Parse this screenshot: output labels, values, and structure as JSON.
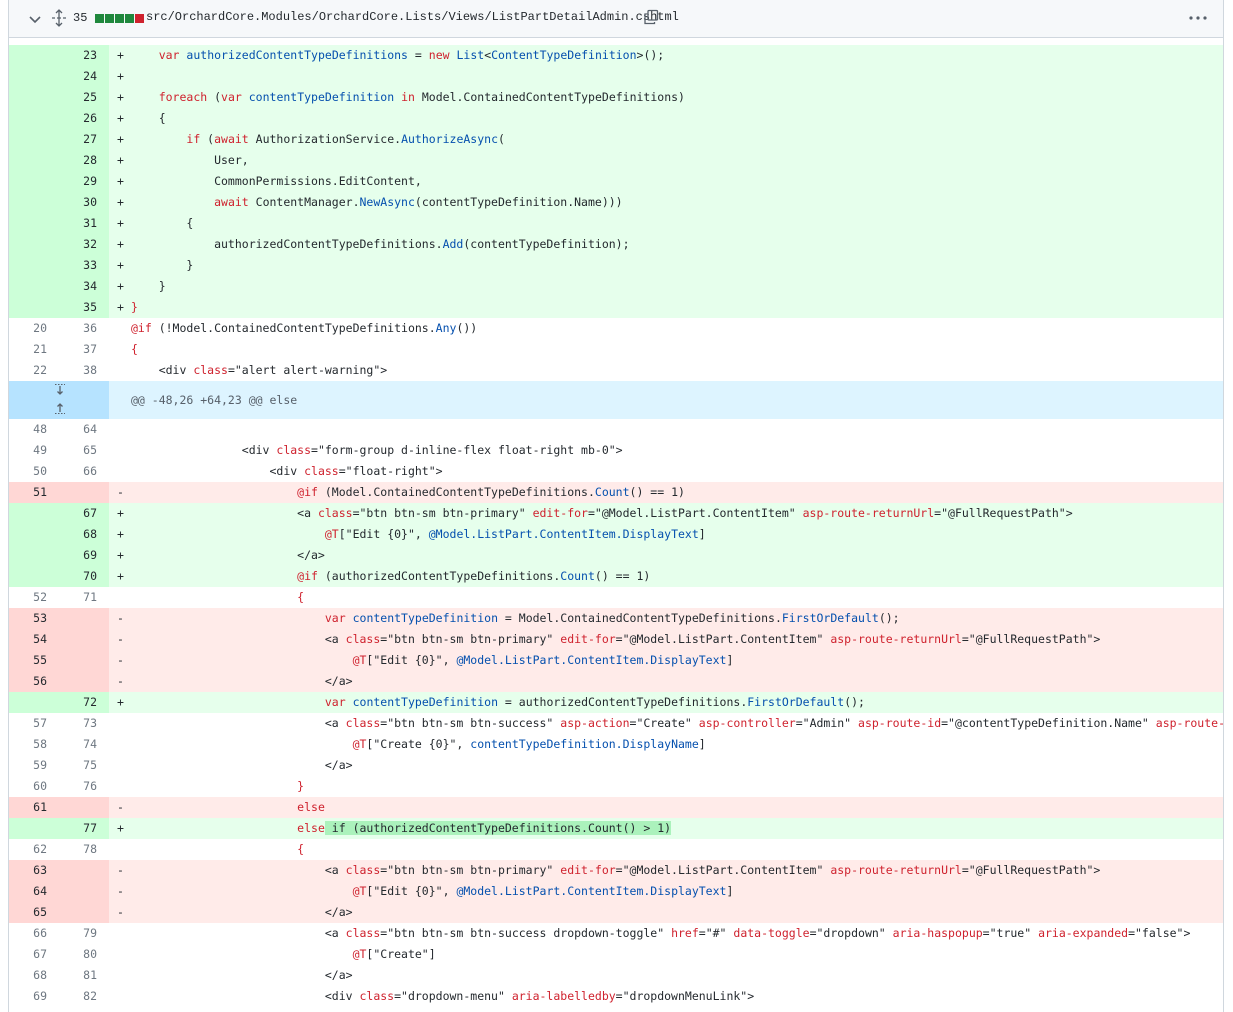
{
  "file": {
    "lines_changed": "35",
    "diff_bars": [
      "#1f883d",
      "#1f883d",
      "#1f883d",
      "#1f883d",
      "#cf222e"
    ],
    "path": "src/OrchardCore.Modules/OrchardCore.Lists/Views/ListPartDetailAdmin.cshtml",
    "icons": {
      "collapse": "chevron-down-icon",
      "expand": "unfold-icon",
      "copy": "copy-icon",
      "menu": "kebab-horizontal-icon"
    }
  },
  "hunk": {
    "header": "@@ -48,26 +64,23 @@ else"
  },
  "colors": {
    "add_bg": "#e6ffec",
    "add_gutter": "#ccffd8",
    "del_bg": "#ffebe9",
    "del_gutter": "#ffd7d5",
    "hunk_bg": "#ddf4ff",
    "hunk_gutter": "#b6e3ff"
  },
  "lines": [
    {
      "t": "add",
      "o": "",
      "n": "23",
      "m": "+",
      "s": [
        [
          "    ",
          ""
        ],
        [
          "var",
          "kw"
        ],
        [
          " ",
          ""
        ],
        [
          "authorizedContentTypeDefinitions",
          "at"
        ],
        [
          " = ",
          ""
        ],
        [
          "new",
          "kw"
        ],
        [
          " ",
          ""
        ],
        [
          "List",
          "at"
        ],
        [
          "<",
          ""
        ],
        [
          "ContentTypeDefinition",
          "at"
        ],
        [
          ">();",
          ""
        ]
      ]
    },
    {
      "t": "add",
      "o": "",
      "n": "24",
      "m": "+",
      "s": []
    },
    {
      "t": "add",
      "o": "",
      "n": "25",
      "m": "+",
      "s": [
        [
          "    ",
          ""
        ],
        [
          "foreach",
          "kw"
        ],
        [
          " (",
          ""
        ],
        [
          "var",
          "kw"
        ],
        [
          " ",
          ""
        ],
        [
          "contentTypeDefinition",
          "at"
        ],
        [
          " ",
          ""
        ],
        [
          "in",
          "kw"
        ],
        [
          " Model.ContainedContentTypeDefinitions)",
          ""
        ]
      ]
    },
    {
      "t": "add",
      "o": "",
      "n": "26",
      "m": "+",
      "s": [
        [
          "    {",
          ""
        ]
      ]
    },
    {
      "t": "add",
      "o": "",
      "n": "27",
      "m": "+",
      "s": [
        [
          "        ",
          ""
        ],
        [
          "if",
          "kw"
        ],
        [
          " (",
          ""
        ],
        [
          "await",
          "kw"
        ],
        [
          " AuthorizationService.",
          ""
        ],
        [
          "AuthorizeAsync",
          "at"
        ],
        [
          "(",
          ""
        ]
      ]
    },
    {
      "t": "add",
      "o": "",
      "n": "28",
      "m": "+",
      "s": [
        [
          "            User,",
          ""
        ]
      ]
    },
    {
      "t": "add",
      "o": "",
      "n": "29",
      "m": "+",
      "s": [
        [
          "            CommonPermissions.EditContent,",
          ""
        ]
      ]
    },
    {
      "t": "add",
      "o": "",
      "n": "30",
      "m": "+",
      "s": [
        [
          "            ",
          ""
        ],
        [
          "await",
          "kw"
        ],
        [
          " ContentManager.",
          ""
        ],
        [
          "NewAsync",
          "at"
        ],
        [
          "(contentTypeDefinition.Name)))",
          ""
        ]
      ]
    },
    {
      "t": "add",
      "o": "",
      "n": "31",
      "m": "+",
      "s": [
        [
          "        {",
          ""
        ]
      ]
    },
    {
      "t": "add",
      "o": "",
      "n": "32",
      "m": "+",
      "s": [
        [
          "            authorizedContentTypeDefinitions.",
          ""
        ],
        [
          "Add",
          "at"
        ],
        [
          "(contentTypeDefinition);",
          ""
        ]
      ]
    },
    {
      "t": "add",
      "o": "",
      "n": "33",
      "m": "+",
      "s": [
        [
          "        }",
          ""
        ]
      ]
    },
    {
      "t": "add",
      "o": "",
      "n": "34",
      "m": "+",
      "s": [
        [
          "    }",
          ""
        ]
      ]
    },
    {
      "t": "add",
      "o": "",
      "n": "35",
      "m": "+",
      "s": [
        [
          "}",
          "kw"
        ]
      ]
    },
    {
      "t": "ctx",
      "o": "20",
      "n": "36",
      "m": "",
      "s": [
        [
          "@if",
          "kw"
        ],
        [
          " (!Model.ContainedContentTypeDefinitions.",
          ""
        ],
        [
          "Any",
          "at"
        ],
        [
          "())",
          ""
        ]
      ]
    },
    {
      "t": "ctx",
      "o": "21",
      "n": "37",
      "m": "",
      "s": [
        [
          "{",
          "kw"
        ]
      ]
    },
    {
      "t": "ctx",
      "o": "22",
      "n": "38",
      "m": "",
      "s": [
        [
          "    <div ",
          ""
        ],
        [
          "class",
          "kw"
        ],
        [
          "=\"alert alert-warning\">",
          ""
        ]
      ]
    },
    {
      "t": "hunk"
    },
    {
      "t": "ctx",
      "o": "48",
      "n": "64",
      "m": "",
      "s": []
    },
    {
      "t": "ctx",
      "o": "49",
      "n": "65",
      "m": "",
      "s": [
        [
          "                <div ",
          ""
        ],
        [
          "class",
          "kw"
        ],
        [
          "=\"form-group d-inline-flex float-right mb-0\">",
          ""
        ]
      ]
    },
    {
      "t": "ctx",
      "o": "50",
      "n": "66",
      "m": "",
      "s": [
        [
          "                    <div ",
          ""
        ],
        [
          "class",
          "kw"
        ],
        [
          "=\"float-right\">",
          ""
        ]
      ]
    },
    {
      "t": "del",
      "o": "51",
      "n": "",
      "m": "-",
      "s": [
        [
          "                        ",
          ""
        ],
        [
          "@if",
          "kw"
        ],
        [
          " (Model.ContainedContentTypeDefinitions.",
          ""
        ],
        [
          "Count",
          "at"
        ],
        [
          "() == 1)",
          ""
        ]
      ]
    },
    {
      "t": "add",
      "o": "",
      "n": "67",
      "m": "+",
      "s": [
        [
          "                        <a ",
          ""
        ],
        [
          "class",
          "kw"
        ],
        [
          "=\"btn btn-sm btn-primary\" ",
          ""
        ],
        [
          "edit-for",
          "kw"
        ],
        [
          "=\"@Model.ListPart.ContentItem\" ",
          ""
        ],
        [
          "asp-route-returnUrl",
          "kw"
        ],
        [
          "=\"@FullRequestPath\">",
          ""
        ]
      ]
    },
    {
      "t": "add",
      "o": "",
      "n": "68",
      "m": "+",
      "s": [
        [
          "                            ",
          ""
        ],
        [
          "@T",
          "kw"
        ],
        [
          "[\"Edit {0}\", ",
          ""
        ],
        [
          "@Model.ListPart.ContentItem.DisplayText",
          "at"
        ],
        [
          "]",
          ""
        ]
      ]
    },
    {
      "t": "add",
      "o": "",
      "n": "69",
      "m": "+",
      "s": [
        [
          "                        </a>",
          ""
        ]
      ]
    },
    {
      "t": "add",
      "o": "",
      "n": "70",
      "m": "+",
      "s": [
        [
          "                        ",
          ""
        ],
        [
          "@if",
          "kw"
        ],
        [
          " (authorizedContentTypeDefinitions.",
          ""
        ],
        [
          "Count",
          "at"
        ],
        [
          "() == 1)",
          ""
        ]
      ]
    },
    {
      "t": "ctx",
      "o": "52",
      "n": "71",
      "m": "",
      "s": [
        [
          "                        ",
          ""
        ],
        [
          "{",
          "kw"
        ]
      ]
    },
    {
      "t": "del",
      "o": "53",
      "n": "",
      "m": "-",
      "s": [
        [
          "                            ",
          ""
        ],
        [
          "var",
          "kw"
        ],
        [
          " ",
          ""
        ],
        [
          "contentTypeDefinition",
          "at"
        ],
        [
          " = Model.ContainedContentTypeDefinitions.",
          ""
        ],
        [
          "FirstOrDefault",
          "at"
        ],
        [
          "();",
          ""
        ]
      ]
    },
    {
      "t": "del",
      "o": "54",
      "n": "",
      "m": "-",
      "s": [
        [
          "                            <a ",
          ""
        ],
        [
          "class",
          "kw"
        ],
        [
          "=\"btn btn-sm btn-primary\" ",
          ""
        ],
        [
          "edit-for",
          "kw"
        ],
        [
          "=\"@Model.ListPart.ContentItem\" ",
          ""
        ],
        [
          "asp-route-returnUrl",
          "kw"
        ],
        [
          "=\"@FullRequestPath\">",
          ""
        ]
      ]
    },
    {
      "t": "del",
      "o": "55",
      "n": "",
      "m": "-",
      "s": [
        [
          "                                ",
          ""
        ],
        [
          "@T",
          "kw"
        ],
        [
          "[\"Edit {0}\", ",
          ""
        ],
        [
          "@Model.ListPart.ContentItem.DisplayText",
          "at"
        ],
        [
          "]",
          ""
        ]
      ]
    },
    {
      "t": "del",
      "o": "56",
      "n": "",
      "m": "-",
      "s": [
        [
          "                            </a>",
          ""
        ]
      ]
    },
    {
      "t": "add",
      "o": "",
      "n": "72",
      "m": "+",
      "s": [
        [
          "                            ",
          ""
        ],
        [
          "var",
          "kw"
        ],
        [
          " ",
          ""
        ],
        [
          "contentTypeDefinition",
          "at"
        ],
        [
          " = authorizedContentTypeDefinitions.",
          ""
        ],
        [
          "FirstOrDefault",
          "at"
        ],
        [
          "();",
          ""
        ]
      ]
    },
    {
      "t": "ctx",
      "o": "57",
      "n": "73",
      "m": "",
      "s": [
        [
          "                            <a ",
          ""
        ],
        [
          "class",
          "kw"
        ],
        [
          "=\"btn btn-sm btn-success\" ",
          ""
        ],
        [
          "asp-action",
          "kw"
        ],
        [
          "=\"Create\" ",
          ""
        ],
        [
          "asp-controller",
          "kw"
        ],
        [
          "=\"Admin\" ",
          ""
        ],
        [
          "asp-route-id",
          "kw"
        ],
        [
          "=\"@contentTypeDefinition.Name\" ",
          ""
        ],
        [
          "asp-route-area",
          "kw"
        ]
      ]
    },
    {
      "t": "ctx",
      "o": "58",
      "n": "74",
      "m": "",
      "s": [
        [
          "                                ",
          ""
        ],
        [
          "@T",
          "kw"
        ],
        [
          "[\"Create {0}\", ",
          ""
        ],
        [
          "contentTypeDefinition.DisplayName",
          "at"
        ],
        [
          "]",
          ""
        ]
      ]
    },
    {
      "t": "ctx",
      "o": "59",
      "n": "75",
      "m": "",
      "s": [
        [
          "                            </a>",
          ""
        ]
      ]
    },
    {
      "t": "ctx",
      "o": "60",
      "n": "76",
      "m": "",
      "s": [
        [
          "                        ",
          ""
        ],
        [
          "}",
          "kw"
        ]
      ]
    },
    {
      "t": "del",
      "o": "61",
      "n": "",
      "m": "-",
      "s": [
        [
          "                        ",
          ""
        ],
        [
          "else",
          "kw"
        ]
      ]
    },
    {
      "t": "add",
      "o": "",
      "n": "77",
      "m": "+",
      "s": [
        [
          "                        ",
          ""
        ],
        [
          "else",
          "kw"
        ],
        [
          " if (authorizedContentTypeDefinitions.Count() > 1)",
          "hl"
        ]
      ]
    },
    {
      "t": "ctx",
      "o": "62",
      "n": "78",
      "m": "",
      "s": [
        [
          "                        ",
          ""
        ],
        [
          "{",
          "kw"
        ]
      ]
    },
    {
      "t": "del",
      "o": "63",
      "n": "",
      "m": "-",
      "s": [
        [
          "                            <a ",
          ""
        ],
        [
          "class",
          "kw"
        ],
        [
          "=\"btn btn-sm btn-primary\" ",
          ""
        ],
        [
          "edit-for",
          "kw"
        ],
        [
          "=\"@Model.ListPart.ContentItem\" ",
          ""
        ],
        [
          "asp-route-returnUrl",
          "kw"
        ],
        [
          "=\"@FullRequestPath\">",
          ""
        ]
      ]
    },
    {
      "t": "del",
      "o": "64",
      "n": "",
      "m": "-",
      "s": [
        [
          "                                ",
          ""
        ],
        [
          "@T",
          "kw"
        ],
        [
          "[\"Edit {0}\", ",
          ""
        ],
        [
          "@Model.ListPart.ContentItem.DisplayText",
          "at"
        ],
        [
          "]",
          ""
        ]
      ]
    },
    {
      "t": "del",
      "o": "65",
      "n": "",
      "m": "-",
      "s": [
        [
          "                            </a>",
          ""
        ]
      ]
    },
    {
      "t": "ctx",
      "o": "66",
      "n": "79",
      "m": "",
      "s": [
        [
          "                            <a ",
          ""
        ],
        [
          "class",
          "kw"
        ],
        [
          "=\"btn btn-sm btn-success dropdown-toggle\" ",
          ""
        ],
        [
          "href",
          "kw"
        ],
        [
          "=\"#\" ",
          ""
        ],
        [
          "data-toggle",
          "kw"
        ],
        [
          "=\"dropdown\" ",
          ""
        ],
        [
          "aria-haspopup",
          "kw"
        ],
        [
          "=\"true\" ",
          ""
        ],
        [
          "aria-expanded",
          "kw"
        ],
        [
          "=\"false\">",
          ""
        ]
      ]
    },
    {
      "t": "ctx",
      "o": "67",
      "n": "80",
      "m": "",
      "s": [
        [
          "                                ",
          ""
        ],
        [
          "@T",
          "kw"
        ],
        [
          "[\"Create\"]",
          ""
        ]
      ]
    },
    {
      "t": "ctx",
      "o": "68",
      "n": "81",
      "m": "",
      "s": [
        [
          "                            </a>",
          ""
        ]
      ]
    },
    {
      "t": "ctx",
      "o": "69",
      "n": "82",
      "m": "",
      "s": [
        [
          "                            <div ",
          ""
        ],
        [
          "class",
          "kw"
        ],
        [
          "=\"dropdown-menu\" ",
          ""
        ],
        [
          "aria-labelledby",
          "kw"
        ],
        [
          "=\"dropdownMenuLink\">",
          ""
        ]
      ]
    }
  ]
}
